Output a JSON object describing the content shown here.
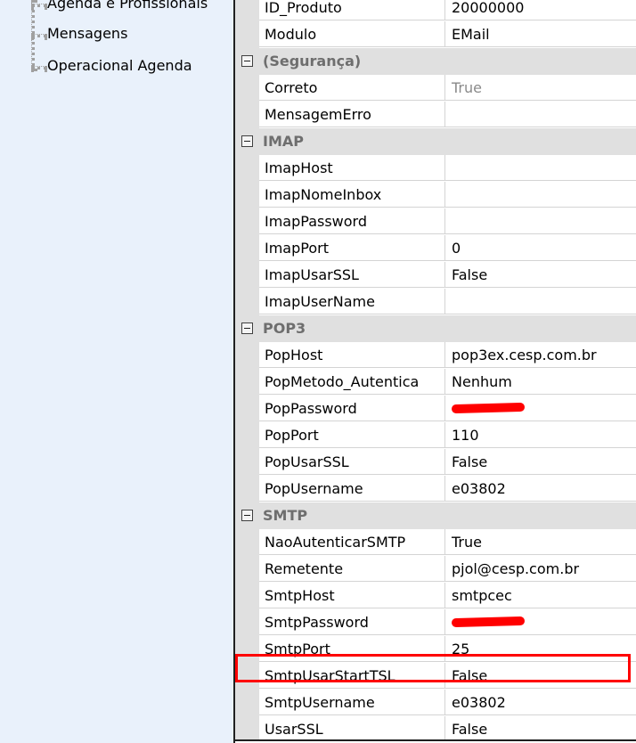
{
  "tree": {
    "items": [
      {
        "label": "Agenda e Profissionais"
      },
      {
        "label": "Mensagens"
      },
      {
        "label": "Operacional Agenda"
      }
    ]
  },
  "grid": {
    "rows": [
      {
        "kind": "prop",
        "name": "ID_Produto",
        "value": "20000000"
      },
      {
        "kind": "prop",
        "name": "Modulo",
        "value": "EMail"
      },
      {
        "kind": "cat",
        "label": "(Segurança)"
      },
      {
        "kind": "prop",
        "name": "Correto",
        "value": "True",
        "muted": true
      },
      {
        "kind": "prop",
        "name": "MensagemErro",
        "value": ""
      },
      {
        "kind": "cat",
        "label": "IMAP"
      },
      {
        "kind": "prop",
        "name": "ImapHost",
        "value": ""
      },
      {
        "kind": "prop",
        "name": "ImapNomeInbox",
        "value": ""
      },
      {
        "kind": "prop",
        "name": "ImapPassword",
        "value": ""
      },
      {
        "kind": "prop",
        "name": "ImapPort",
        "value": "0"
      },
      {
        "kind": "prop",
        "name": "ImapUsarSSL",
        "value": "False"
      },
      {
        "kind": "prop",
        "name": "ImapUserName",
        "value": ""
      },
      {
        "kind": "cat",
        "label": "POP3"
      },
      {
        "kind": "prop",
        "name": "PopHost",
        "value": "pop3ex.cesp.com.br"
      },
      {
        "kind": "prop",
        "name": "PopMetodo_Autentica",
        "value": "Nenhum"
      },
      {
        "kind": "prop",
        "name": "PopPassword",
        "value": "",
        "redacted": true
      },
      {
        "kind": "prop",
        "name": "PopPort",
        "value": "110"
      },
      {
        "kind": "prop",
        "name": "PopUsarSSL",
        "value": "False"
      },
      {
        "kind": "prop",
        "name": "PopUsername",
        "value": "e03802"
      },
      {
        "kind": "cat",
        "label": "SMTP"
      },
      {
        "kind": "prop",
        "name": "NaoAutenticarSMTP",
        "value": "True"
      },
      {
        "kind": "prop",
        "name": "Remetente",
        "value": "pjol@cesp.com.br"
      },
      {
        "kind": "prop",
        "name": "SmtpHost",
        "value": "smtpcec"
      },
      {
        "kind": "prop",
        "name": "SmtpPassword",
        "value": "",
        "redacted": true
      },
      {
        "kind": "prop",
        "name": "SmtpPort",
        "value": "25"
      },
      {
        "kind": "prop",
        "name": "SmtpUsarStartTSL",
        "value": "False",
        "highlighted": true
      },
      {
        "kind": "prop",
        "name": "SmtpUsername",
        "value": "e03802"
      },
      {
        "kind": "prop",
        "name": "UsarSSL",
        "value": "False"
      }
    ]
  },
  "colors": {
    "tree_background": "#e9f1fb",
    "category_background": "#e0e0e0",
    "highlight": "#ff0000",
    "redaction": "#ff0000"
  }
}
